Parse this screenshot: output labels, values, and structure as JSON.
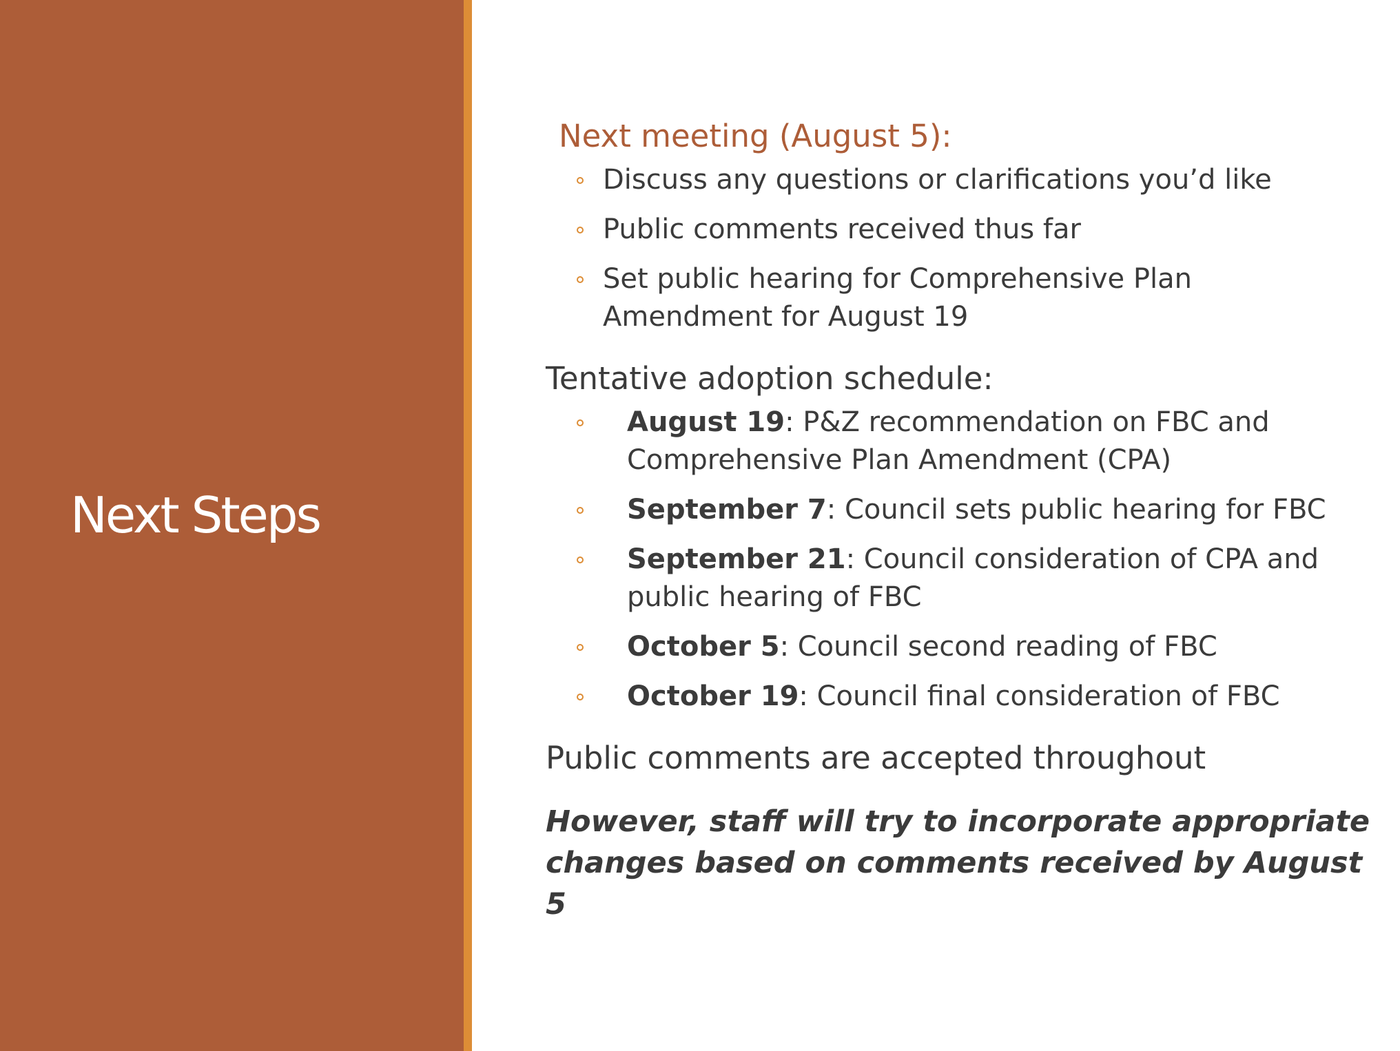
{
  "slide": {
    "title": "Next Steps",
    "colors": {
      "panel": "#ad5d38",
      "accent_bar": "#dd8d36",
      "heading_orange": "#ad5d38",
      "body_text": "#3b3b3b"
    }
  },
  "next_meeting": {
    "heading": "Next meeting (August 5):",
    "items": [
      "Discuss any questions or clarifications you’d like",
      "Public comments received thus far",
      "Set public hearing for Comprehensive Plan Amendment for August 19"
    ]
  },
  "schedule": {
    "heading": "Tentative adoption schedule:",
    "items": [
      {
        "date": "August 19",
        "text": ": P&Z recommendation on FBC and Comprehensive Plan Amendment (CPA)"
      },
      {
        "date": "September 7",
        "text": ": Council sets public hearing for FBC"
      },
      {
        "date": "September 21",
        "text": ": Council consideration of CPA and public hearing of FBC"
      },
      {
        "date": "October 5",
        "text": ": Council second reading of FBC"
      },
      {
        "date": "October 19",
        "text": ": Council final consideration of FBC"
      }
    ]
  },
  "public_comments": "Public comments are accepted throughout",
  "closing_note": "However, staff will try to incorporate appropriate changes based on comments received by August 5"
}
